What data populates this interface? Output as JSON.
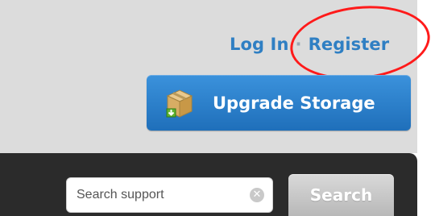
{
  "header": {
    "login_label": "Log In",
    "separator": "·",
    "register_label": "Register",
    "annotation_color": "#ff1a1a"
  },
  "upgrade": {
    "label": "Upgrade Storage",
    "icon": "storage-box-download-icon"
  },
  "search": {
    "placeholder": "Search support",
    "clear_icon": "clear-icon",
    "button_label": "Search"
  },
  "colors": {
    "link_blue": "#2f7fc3",
    "button_blue": "#2a80cc",
    "dark_bar": "#2b2b2b",
    "top_bg": "#dcdcdc"
  }
}
